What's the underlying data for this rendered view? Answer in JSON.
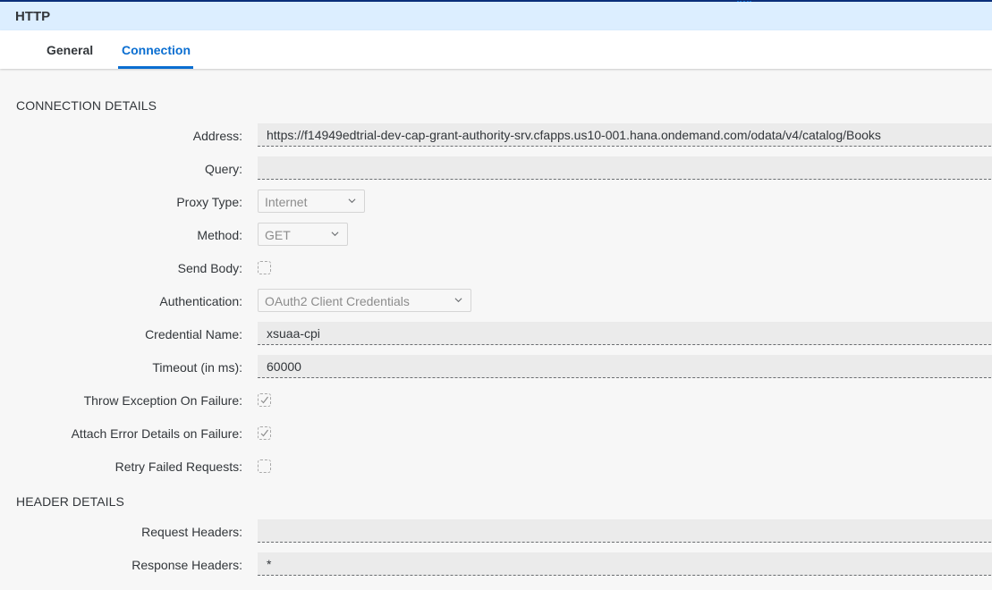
{
  "window": {
    "title": "HTTP"
  },
  "tabs": [
    {
      "label": "General",
      "active": false
    },
    {
      "label": "Connection",
      "active": true
    }
  ],
  "connection_details": {
    "section_title": "CONNECTION DETAILS",
    "address": {
      "label": "Address:",
      "value": "https://f14949edtrial-dev-cap-grant-authority-srv.cfapps.us10-001.hana.ondemand.com/odata/v4/catalog/Books"
    },
    "query": {
      "label": "Query:",
      "value": ""
    },
    "proxy_type": {
      "label": "Proxy Type:",
      "value": "Internet"
    },
    "method": {
      "label": "Method:",
      "value": "GET"
    },
    "send_body": {
      "label": "Send Body:",
      "checked": false
    },
    "authentication": {
      "label": "Authentication:",
      "value": "OAuth2 Client Credentials"
    },
    "credential_name": {
      "label": "Credential Name:",
      "value": "xsuaa-cpi"
    },
    "timeout": {
      "label": "Timeout (in ms):",
      "value": "60000"
    },
    "throw_exception": {
      "label": "Throw Exception On Failure:",
      "checked": true
    },
    "attach_error_details": {
      "label": "Attach Error Details on Failure:",
      "checked": true
    },
    "retry_failed": {
      "label": "Retry Failed Requests:",
      "checked": false
    }
  },
  "header_details": {
    "section_title": "HEADER DETAILS",
    "request_headers": {
      "label": "Request Headers:",
      "value": ""
    },
    "response_headers": {
      "label": "Response Headers:",
      "value": "*"
    }
  },
  "colors": {
    "accent": "#0a6ed1",
    "header_bg": "#dceeff",
    "page_bg": "#f7f7f7",
    "field_bg": "#ebebeb"
  }
}
